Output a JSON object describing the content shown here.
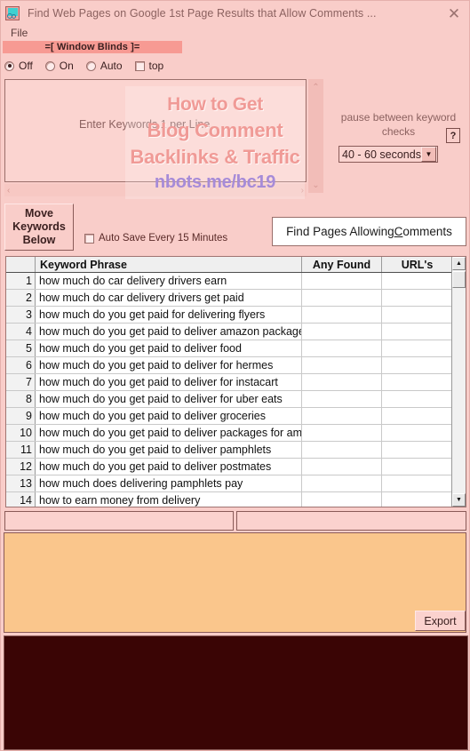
{
  "window": {
    "title": "Find Web Pages on Google 1st Page Results that Allow Comments ...",
    "icon": "app-magnifier-icon",
    "close_label": "✕"
  },
  "menu": {
    "items": [
      {
        "label": "File"
      }
    ]
  },
  "blinds": {
    "title": "=[ Window Blinds ]=",
    "options": [
      {
        "label": "Off",
        "selected": true
      },
      {
        "label": "On",
        "selected": false
      },
      {
        "label": "Auto",
        "selected": false
      }
    ],
    "top_checkbox": {
      "label": "top",
      "checked": false
    }
  },
  "keywords": {
    "placeholder": "Enter Keywords 1 per Line",
    "value": "",
    "scroll_up_glyph": "⌃",
    "scroll_down_glyph": "⌄",
    "scroll_left_glyph": "‹",
    "scroll_right_glyph": "›"
  },
  "watermark": {
    "line1": "How to Get",
    "line2": "Blog Comment",
    "line3": "Backlinks & Traffic",
    "line4": "nbots.me/bc19",
    "color_text": "#f09a96",
    "color_url": "#a68bd8"
  },
  "pause": {
    "label": "pause between keyword checks",
    "help_label": "?",
    "selected_option": "40 - 60 seconds",
    "dropdown_glyph": "▼"
  },
  "actions": {
    "move_keywords_line1": "Move",
    "move_keywords_line2": "Keywords",
    "move_keywords_line3": "Below",
    "autosave_label": "Auto Save Every 15 Minutes",
    "autosave_checked": false,
    "find_pages_pre": "Find Pages Allowing ",
    "find_pages_accel": "C",
    "find_pages_post": "omments",
    "export_label": "Export"
  },
  "grid": {
    "columns": [
      "",
      "Keyword Phrase",
      "Any Found",
      "URL's"
    ],
    "rows": [
      {
        "n": "1",
        "phrase": "how much do car delivery drivers earn",
        "found": "",
        "urls": ""
      },
      {
        "n": "2",
        "phrase": "how much do car delivery drivers get paid",
        "found": "",
        "urls": ""
      },
      {
        "n": "3",
        "phrase": "how much do you get paid for delivering flyers",
        "found": "",
        "urls": ""
      },
      {
        "n": "4",
        "phrase": "how much do you get paid to deliver amazon packages",
        "found": "",
        "urls": ""
      },
      {
        "n": "5",
        "phrase": "how much do you get paid to deliver food",
        "found": "",
        "urls": ""
      },
      {
        "n": "6",
        "phrase": "how much do you get paid to deliver for hermes",
        "found": "",
        "urls": ""
      },
      {
        "n": "7",
        "phrase": "how much do you get paid to deliver for instacart",
        "found": "",
        "urls": ""
      },
      {
        "n": "8",
        "phrase": "how much do you get paid to deliver for uber eats",
        "found": "",
        "urls": ""
      },
      {
        "n": "9",
        "phrase": "how much do you get paid to deliver groceries",
        "found": "",
        "urls": ""
      },
      {
        "n": "10",
        "phrase": "how much do you get paid to deliver packages for amazon",
        "found": "",
        "urls": ""
      },
      {
        "n": "11",
        "phrase": "how much do you get paid to deliver pamphlets",
        "found": "",
        "urls": ""
      },
      {
        "n": "12",
        "phrase": "how much do you get paid to deliver postmates",
        "found": "",
        "urls": ""
      },
      {
        "n": "13",
        "phrase": "how much does delivering pamphlets pay",
        "found": "",
        "urls": ""
      },
      {
        "n": "14",
        "phrase": "how to earn money from delivery",
        "found": "",
        "urls": ""
      }
    ],
    "scroll_up_glyph": "▲",
    "scroll_down_glyph": "▼"
  },
  "bottom_fields": {
    "left_value": "",
    "right_value": ""
  },
  "results_panel": {
    "value": ""
  },
  "log_panel": {
    "value": ""
  },
  "colors": {
    "window_bg": "#f9cdc9",
    "accent_bar": "#f79a93",
    "peach_panel": "#fac68c",
    "dark_panel": "#3a0505"
  }
}
